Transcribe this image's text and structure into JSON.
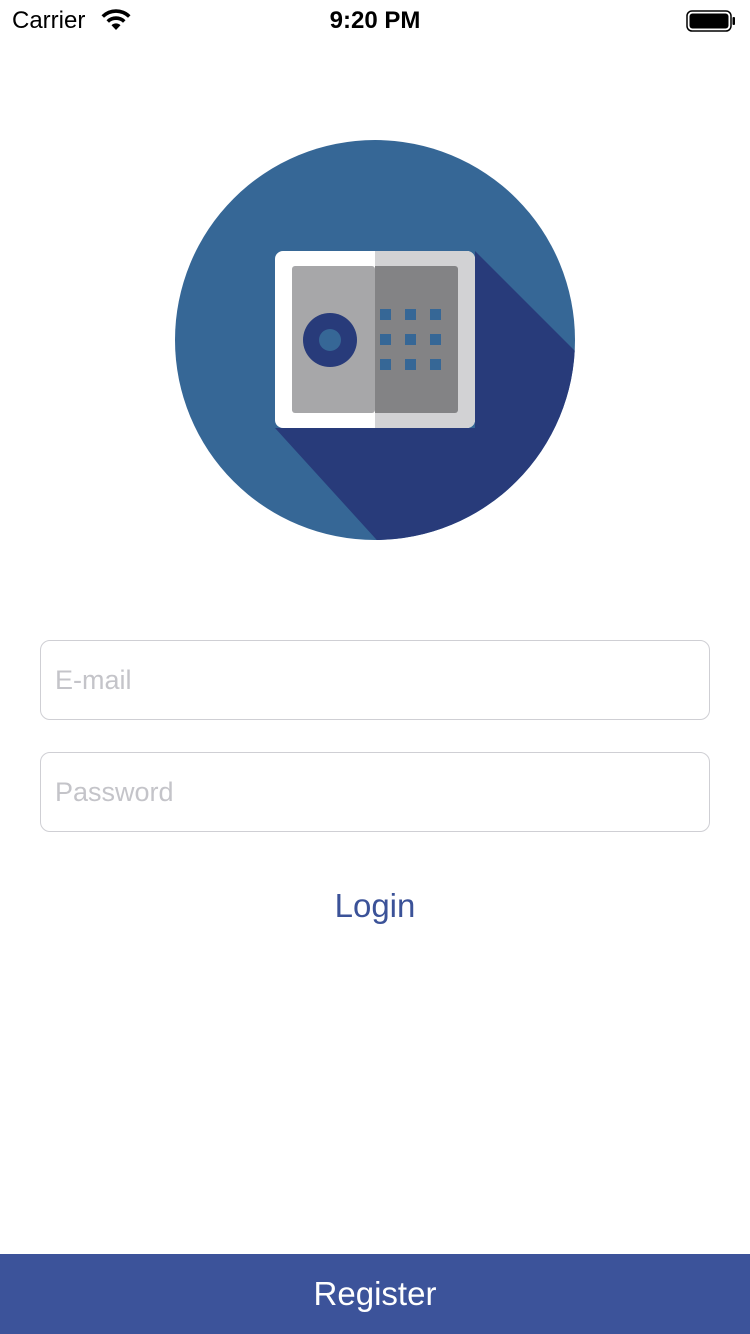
{
  "status_bar": {
    "carrier": "Carrier",
    "time": "9:20 PM",
    "wifi_icon": "wifi-icon",
    "battery_icon": "battery-icon"
  },
  "logo": {
    "icon": "safe-icon",
    "colors": {
      "circle": "#366796",
      "shadow": "#283b7a",
      "frame": "#ffffff",
      "frame_right": "#d2d2d4",
      "door_left": "#a7a7a9",
      "door_right": "#838385",
      "dial_outer": "#283b7a",
      "dial_inner": "#366796",
      "keypad": "#366796"
    }
  },
  "form": {
    "email_placeholder": "E-mail",
    "email_value": "",
    "password_placeholder": "Password",
    "password_value": "",
    "login_label": "Login"
  },
  "footer": {
    "register_label": "Register",
    "register_color": "#3c539a"
  }
}
